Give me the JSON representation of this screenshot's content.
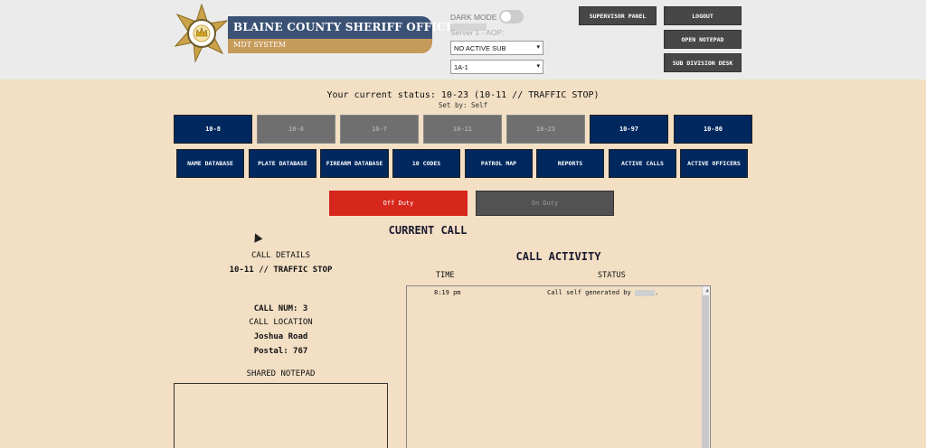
{
  "header": {
    "agency_name": "BLAINE COUNTY SHERIFF OFFICE",
    "system_name": "MDT SYSTEM",
    "dark_mode_label": "DARK MODE",
    "server_label": "Server 1 - AOP:",
    "sub_select_value": "NO ACTIVE SUB",
    "unit_select_value": "1A-1",
    "supervisor_label": "SUPERVISOR PANEL",
    "logout_label": "LOGOUT",
    "notepad_label": "OPEN NOTEPAD",
    "subdivision_label": "SUB DIVISION DESK"
  },
  "status": {
    "current": "Your current status: 10-23 (10-11 // TRAFFIC STOP)",
    "set_by": "Set by: Self"
  },
  "codes": [
    {
      "label": "10-8",
      "active": true
    },
    {
      "label": "10-6",
      "active": false
    },
    {
      "label": "10-7",
      "active": false
    },
    {
      "label": "10-11",
      "active": false
    },
    {
      "label": "10-23",
      "active": false
    },
    {
      "label": "10-97",
      "active": true
    },
    {
      "label": "10-80",
      "active": true
    }
  ],
  "nav": {
    "name_db": "NAME DATABASE",
    "plate_db": "PLATE DATABASE",
    "firearm_db": "FIREARM DATABASE",
    "ten_codes": "10 CODES",
    "patrol_map": "PATROL MAP",
    "reports": "REPORTS",
    "active_calls": "ACTIVE CALLS",
    "active_officers": "ACTIVE OFFICERS"
  },
  "duty": {
    "off_label": "Off Duty",
    "on_label": "On Duty"
  },
  "current_call": {
    "heading": "CURRENT CALL",
    "details_label": "CALL DETAILS",
    "details_value": "10-11 // TRAFFIC STOP",
    "call_num": "CALL NUM: 3",
    "location_label": "CALL LOCATION",
    "location_value": "Joshua Road",
    "postal": "Postal: 767",
    "notepad_label": "SHARED NOTEPAD"
  },
  "activity": {
    "heading": "CALL ACTIVITY",
    "col_time": "TIME",
    "col_status": "STATUS",
    "rows": [
      {
        "time": "8:19 pm",
        "status": "Call self generated by"
      }
    ]
  }
}
